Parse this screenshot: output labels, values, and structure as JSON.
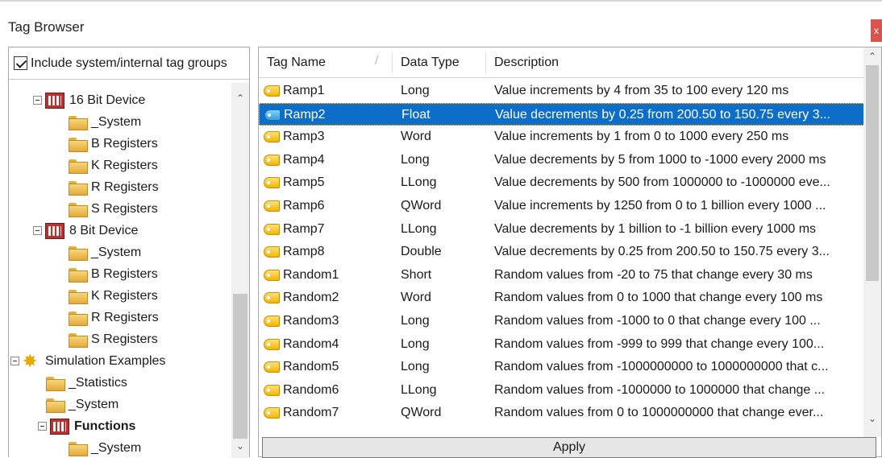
{
  "window": {
    "title": "Tag Browser",
    "close_label": "x"
  },
  "left_panel": {
    "include_checkbox_label": "Include system/internal tag groups",
    "include_checked": true,
    "tree": [
      {
        "label": "16 Bit Device",
        "icon": "device-icon",
        "bold": false
      },
      {
        "label": "_System",
        "icon": "folder-icon"
      },
      {
        "label": "B Registers",
        "icon": "folder-icon"
      },
      {
        "label": "K Registers",
        "icon": "folder-icon"
      },
      {
        "label": "R Registers",
        "icon": "folder-icon"
      },
      {
        "label": "S Registers",
        "icon": "folder-icon"
      },
      {
        "label": "8 Bit Device",
        "icon": "device-icon",
        "bold": false
      },
      {
        "label": "_System",
        "icon": "folder-icon"
      },
      {
        "label": "B Registers",
        "icon": "folder-icon"
      },
      {
        "label": "K Registers",
        "icon": "folder-icon"
      },
      {
        "label": "R Registers",
        "icon": "folder-icon"
      },
      {
        "label": "S Registers",
        "icon": "folder-icon"
      },
      {
        "label": "Simulation Examples",
        "icon": "gear-icon"
      },
      {
        "label": "_Statistics",
        "icon": "folder-icon"
      },
      {
        "label": "_System",
        "icon": "folder-icon"
      },
      {
        "label": "Functions",
        "icon": "device-icon",
        "bold": true
      },
      {
        "label": "_System",
        "icon": "folder-icon"
      }
    ]
  },
  "table": {
    "columns": [
      "Tag Name",
      "Data Type",
      "Description"
    ],
    "selected_row": 1,
    "rows": [
      {
        "name": "Ramp1",
        "type": "Long",
        "description": "Value increments by 4 from 35 to 100 every 120  ms"
      },
      {
        "name": "Ramp2",
        "type": "Float",
        "description": "Value decrements by 0.25 from 200.50 to 150.75 every 3..."
      },
      {
        "name": "Ramp3",
        "type": "Word",
        "description": "Value increments by 1 from 0 to 1000 every 250  ms"
      },
      {
        "name": "Ramp4",
        "type": "Long",
        "description": "Value decrements by 5 from 1000 to -1000 every 2000  ms"
      },
      {
        "name": "Ramp5",
        "type": "LLong",
        "description": "Value decrements by 500 from 1000000 to -1000000 eve..."
      },
      {
        "name": "Ramp6",
        "type": "QWord",
        "description": "Value increments by 1250 from 0 to 1 billion every 1000 ..."
      },
      {
        "name": "Ramp7",
        "type": "LLong",
        "description": "Value decrements by 1 billion to -1 billion every 1000  ms"
      },
      {
        "name": "Ramp8",
        "type": "Double",
        "description": "Value decrements by 0.25 from 200.50 to 150.75 every 3..."
      },
      {
        "name": "Random1",
        "type": "Short",
        "description": "Random values from -20 to 75 that change every 30 ms"
      },
      {
        "name": "Random2",
        "type": "Word",
        "description": "Random values from 0 to 1000 that change every 100 ms"
      },
      {
        "name": "Random3",
        "type": "Long",
        "description": "Random values from -1000 to 0 that change every 100 ..."
      },
      {
        "name": "Random4",
        "type": "Long",
        "description": "Random values from -999 to 999 that change every 100..."
      },
      {
        "name": "Random5",
        "type": "Long",
        "description": "Random values from -1000000000 to 1000000000 that c..."
      },
      {
        "name": "Random6",
        "type": "LLong",
        "description": "Random values from -1000000 to 1000000 that change ..."
      },
      {
        "name": "Random7",
        "type": "QWord",
        "description": "Random values from 0 to 1000000000 that change ever..."
      }
    ],
    "apply_label": "Apply"
  },
  "colors": {
    "selection": "#0d6ec9",
    "close": "#d9534f"
  }
}
